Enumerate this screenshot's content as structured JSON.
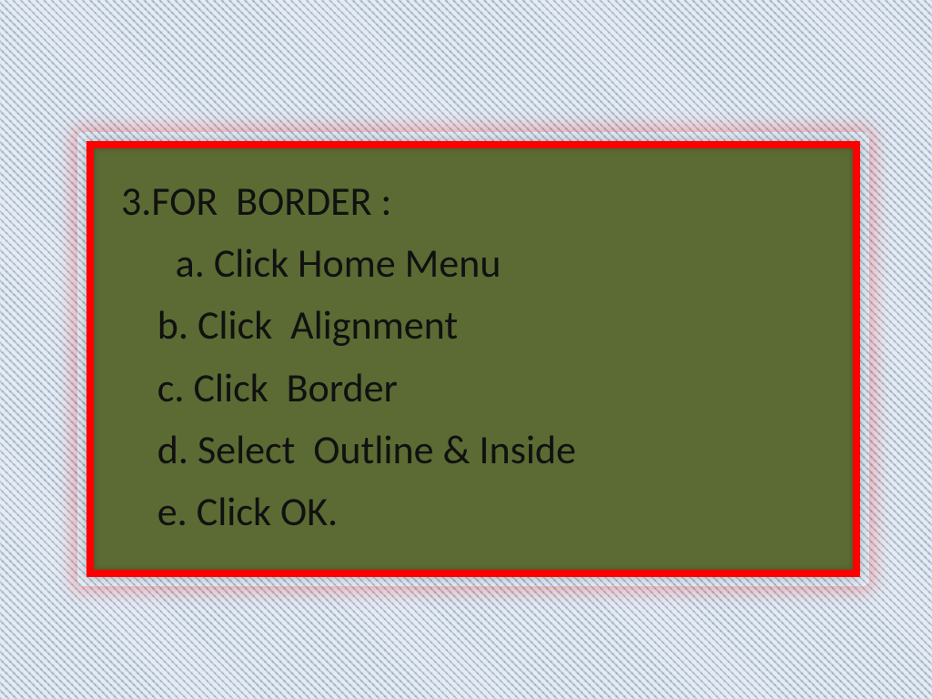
{
  "slide": {
    "heading": "3.FOR  BORDER :",
    "step_a": "      a. Click Home Menu",
    "step_b": "    b. Click  Alignment",
    "step_c": "    c. Click  Border",
    "step_d": "    d. Select  Outline & Inside",
    "step_e": "    e. Click OK."
  },
  "colors": {
    "box_fill": "#5b6b33",
    "box_border": "#ff0000",
    "bg_weave_light": "#eef2f6",
    "bg_weave_dark": "#6482aa"
  }
}
